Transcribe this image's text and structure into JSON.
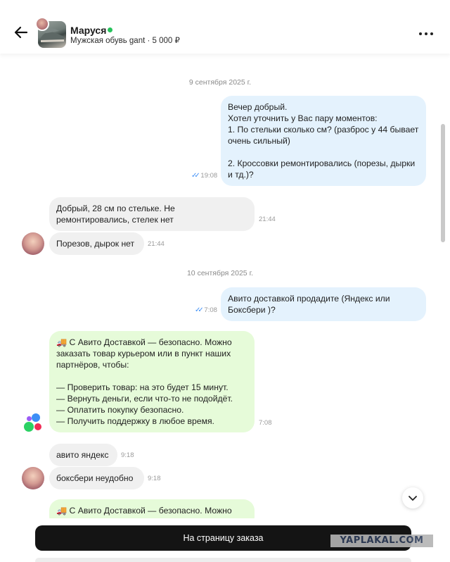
{
  "header": {
    "name": "Маруся",
    "subtitle": "Мужская обувь gant · 5 000 ₽"
  },
  "dates": [
    "9 сентября 2025 г.",
    "10 сентября 2025 г."
  ],
  "messages": [
    {
      "text": "Вечер добрый.\nХотел уточнить у Вас пару моментов:\n1. По стельки сколько см? (разброс у 44 бывает очень сильный)\n\n2. Кроссовки ремонтировались (порезы, дырки и тд.)?",
      "time": "19:08"
    },
    {
      "text": "Добрый,  28 см по стельке. Не ремонтировались, стелек нет",
      "time": "21:44"
    },
    {
      "text": "Порезов, дырок нет",
      "time": "21:44"
    },
    {
      "text": "Авито доставкой продадите (Яндекс или Боксбери )?",
      "time": "7:08"
    },
    {
      "text": "🚚 С Авито Доставкой — безопасно. Можно заказать товар курьером или в пункт наших партнёров, чтобы:\n\n— Проверить товар: на это будет 15 минут.\n— Вернуть деньги, если что-то не подойдёт.\n— Оплатить покупку безопасно.\n— Получить поддержку в любое время.",
      "time": "7:08"
    },
    {
      "text": "авито яндекс",
      "time": "9:18"
    },
    {
      "text": "боксбери неудобно",
      "time": "9:18"
    },
    {
      "text": "🚚 С Авито Доставкой — безопасно. Можно",
      "time": ""
    }
  ],
  "read_ticks": "✓✓",
  "footer": {
    "order_button": "На страницу заказа",
    "watermark": "YAPLAKAL.COM"
  },
  "colors": {
    "outgoing": "#e4f2fd",
    "incoming": "#f0f0f0",
    "system": "#e6fbd9",
    "online": "#26c25b",
    "button": "#141414"
  },
  "icons": [
    "back-arrow-icon",
    "online-dot",
    "more-menu-icon",
    "double-check-icon",
    "chevron-down-icon",
    "avito-logo"
  ]
}
